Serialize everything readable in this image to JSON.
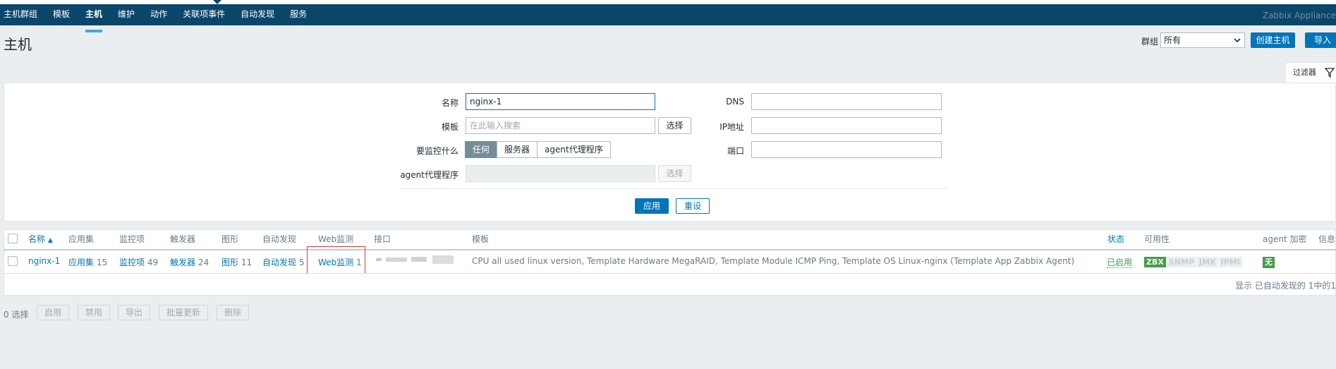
{
  "topnav": {
    "items": [
      "主机群组",
      "模板",
      "主机",
      "维护",
      "动作",
      "关联项事件",
      "自动发现",
      "服务"
    ],
    "active_index": 2,
    "brand": "Zabbix Appliance"
  },
  "header": {
    "title": "主机",
    "group_label": "群组",
    "group_value": "所有",
    "create_button": "创建主机",
    "import_button": "导入"
  },
  "filter": {
    "tab_label": "过滤器",
    "name_label": "名称",
    "name_value": "nginx-1",
    "template_label": "模板",
    "template_placeholder": "在此输入搜索",
    "select_button": "选择",
    "monitor_label": "要监控什么",
    "monitor_options": [
      "任何",
      "服务器",
      "agent代理程序"
    ],
    "monitor_selected": 0,
    "proxy_label": "agent代理程序",
    "proxy_select_button": "选择",
    "dns_label": "DNS",
    "ip_label": "IP地址",
    "port_label": "端口",
    "apply_button": "应用",
    "reset_button": "重设"
  },
  "table": {
    "columns": {
      "name": "名称",
      "applications": "应用集",
      "items": "监控项",
      "triggers": "触发器",
      "graphs": "图形",
      "discovery": "自动发现",
      "web": "Web监测",
      "interface": "接口",
      "templates": "模板",
      "status": "状态",
      "availability": "可用性",
      "encryption": "agent 加密",
      "info": "信息"
    },
    "sort_indicator": "▲",
    "rows": [
      {
        "name": "nginx-1",
        "applications": "应用集",
        "applications_count": "15",
        "items": "监控项",
        "items_count": "49",
        "triggers": "触发器",
        "triggers_count": "24",
        "graphs": "图形",
        "graphs_count": "11",
        "discovery": "自动发现",
        "discovery_count": "5",
        "web": "Web监测",
        "web_count": "1",
        "templates_main": "CPU all used linux version, Template Hardware MegaRAID, Template Module ICMP Ping, Template OS Linux-nginx",
        "templates_paren": "(Template App Zabbix Agent)",
        "status": "已启用",
        "availability": [
          "ZBX",
          "SNMP",
          "JMX",
          "IPMI"
        ],
        "encryption": "无"
      }
    ],
    "footer_note": "显示 已自动发现的 1中的1"
  },
  "bulk": {
    "count": "0 选择",
    "buttons": [
      "启用",
      "禁用",
      "导出",
      "批量更新",
      "删除"
    ]
  },
  "colors": {
    "nav_bg": "#0a466a",
    "accent": "#0275b8",
    "ok_green": "#429e47",
    "highlight_red": "#e03a3a"
  }
}
